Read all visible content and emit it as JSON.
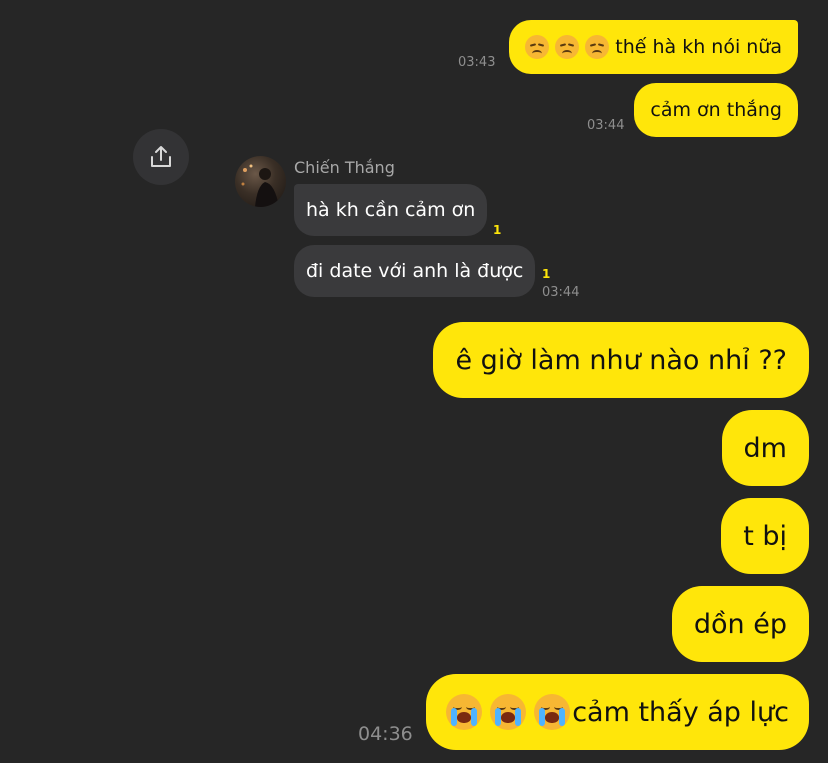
{
  "chat": {
    "sender_name": "Chiến Thắng",
    "messages": [
      {
        "from": "me",
        "emoji": [
          "disappointed-face",
          "disappointed-face",
          "disappointed-face"
        ],
        "text": "thế hà kh nói nữa",
        "time": "03:43"
      },
      {
        "from": "me",
        "text": "cảm ơn thắng",
        "time": "03:44"
      },
      {
        "from": "other",
        "text": "hà kh cần cảm ơn",
        "unread": "1"
      },
      {
        "from": "other",
        "text": "đi date với anh là được",
        "unread": "1",
        "time": "03:44"
      },
      {
        "from": "me",
        "text": "ê giờ làm như nào nhỉ ??"
      },
      {
        "from": "me",
        "text": "dm"
      },
      {
        "from": "me",
        "text": "t bị"
      },
      {
        "from": "me",
        "text": "dồn ép"
      },
      {
        "from": "me",
        "emoji": [
          "loudly-crying-face",
          "loudly-crying-face",
          "loudly-crying-face"
        ],
        "text": "cảm thấy áp lực",
        "time": "04:36"
      }
    ]
  },
  "icons": {
    "share": "share-upload-icon",
    "avatar": "profile-photo"
  },
  "colors": {
    "background": "#262626",
    "my_bubble": "#ffe60a",
    "their_bubble": "#3a3a3c",
    "unread_marker": "#ffe60a",
    "timestamp": "#8e8e8e"
  }
}
